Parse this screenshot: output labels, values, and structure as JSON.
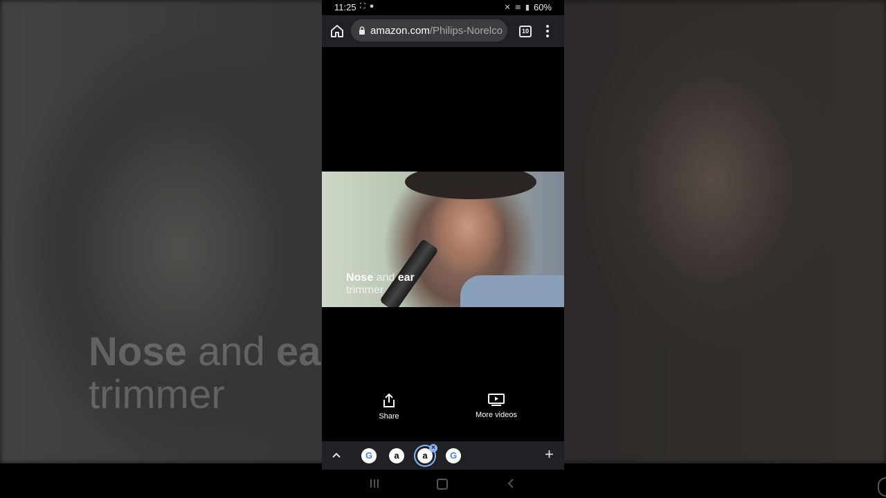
{
  "status_bar": {
    "time": "11:25",
    "battery": "60%"
  },
  "browser": {
    "url_domain": "amazon.com",
    "url_path": "/Philips-Norelco",
    "tab_count": "10"
  },
  "video": {
    "caption_word1": "Nose",
    "caption_word2": " and ",
    "caption_word3": "ear",
    "caption_line2": "trimmer"
  },
  "actions": {
    "share_label": "Share",
    "more_videos_label": "More videos"
  },
  "tabstrip": {
    "tabs": [
      {
        "icon": "google-favicon",
        "glyph": "G"
      },
      {
        "icon": "amazon-favicon",
        "glyph": "a"
      },
      {
        "icon": "amazon-favicon",
        "glyph": "a",
        "active": true
      },
      {
        "icon": "google-favicon",
        "glyph": "G"
      }
    ],
    "close_glyph": "×",
    "new_tab_glyph": "+"
  },
  "colors": {
    "toolbar_bg": "#202124",
    "url_pill_bg": "#3c3c3f",
    "active_tab_ring": "#8ab4f8"
  }
}
